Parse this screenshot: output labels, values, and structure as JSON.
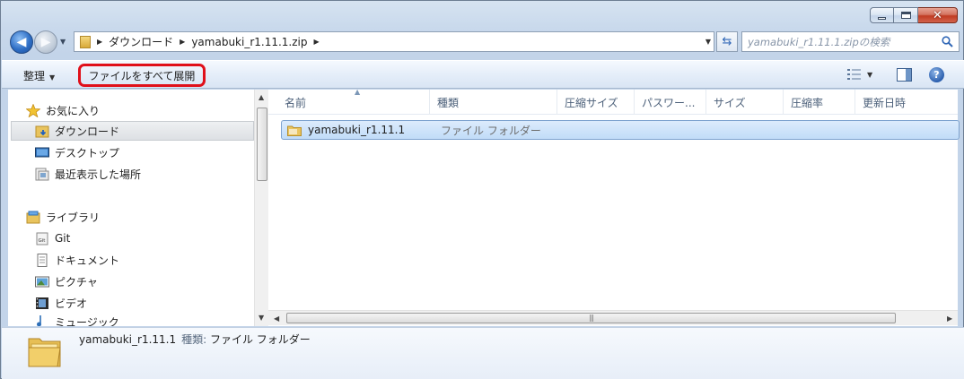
{
  "window": {
    "controls": {
      "minimize": "minimize",
      "maximize": "maximize",
      "close": "✕"
    }
  },
  "address": {
    "crumbs": [
      "ダウンロード",
      "yamabuki_r1.11.1.zip"
    ]
  },
  "search": {
    "placeholder": "yamabuki_r1.11.1.zipの検索"
  },
  "toolbar": {
    "organize_label": "整理",
    "extract_all_label": "ファイルをすべて展開",
    "highlight_color": "#e0101a"
  },
  "navigation": {
    "favorites": {
      "header": "お気に入り",
      "items": [
        "ダウンロード",
        "デスクトップ",
        "最近表示した場所"
      ],
      "selected": "ダウンロード"
    },
    "libraries": {
      "header": "ライブラリ",
      "items": [
        "Git",
        "ドキュメント",
        "ピクチャ",
        "ビデオ",
        "ミュージック"
      ]
    }
  },
  "columns": [
    "名前",
    "種類",
    "圧縮サイズ",
    "パスワー...",
    "サイズ",
    "圧縮率",
    "更新日時"
  ],
  "files": [
    {
      "name": "yamabuki_r1.11.1",
      "type": "ファイル フォルダー",
      "selected": true
    }
  ],
  "details": {
    "name": "yamabuki_r1.11.1",
    "type_label": "種類:",
    "type_value": "ファイル フォルダー"
  }
}
